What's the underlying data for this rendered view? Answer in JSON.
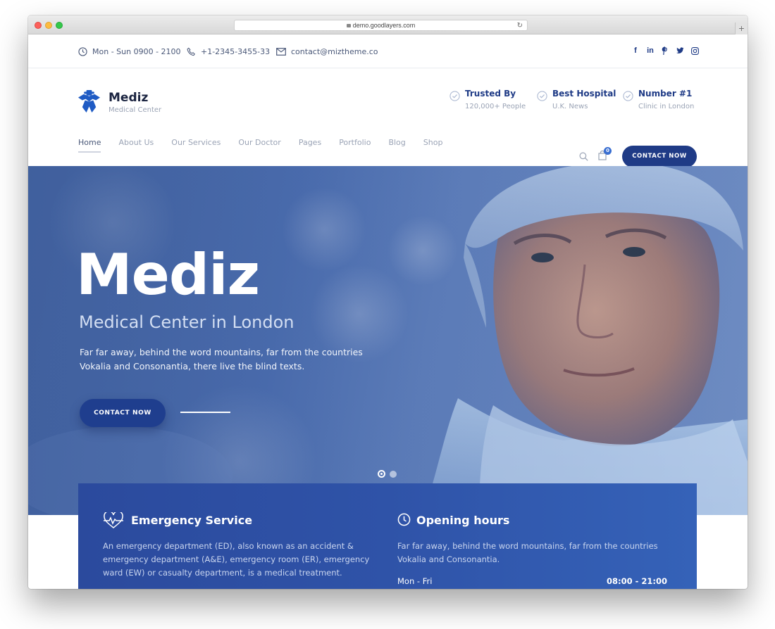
{
  "browser": {
    "url": "demo.goodlayers.com"
  },
  "topbar": {
    "hours": "Mon - Sun 0900 - 2100",
    "phone": "+1-2345-3455-33",
    "email": "contact@miztheme.co",
    "socials": [
      "facebook-icon",
      "linkedin-icon",
      "pinterest-icon",
      "twitter-icon",
      "instagram-icon"
    ]
  },
  "header": {
    "logo": {
      "name": "Mediz",
      "tagline": "Medical Center"
    },
    "badges": [
      {
        "title": "Trusted By",
        "subtitle": "120,000+ People"
      },
      {
        "title": "Best Hospital",
        "subtitle": "U.K. News"
      },
      {
        "title": "Number #1",
        "subtitle": "Clinic in London"
      }
    ],
    "nav": [
      "Home",
      "About Us",
      "Our Services",
      "Our Doctor",
      "Pages",
      "Portfolio",
      "Blog",
      "Shop"
    ],
    "active_nav": "Home",
    "cart_count": "0",
    "cta": "CONTACT NOW"
  },
  "hero": {
    "title": "Mediz",
    "subtitle": "Medical Center in London",
    "description": "Far far away, behind the word mountains, far from the countries Vokalia and Consonantia, there live the blind texts.",
    "cta": "CONTACT NOW",
    "slides": 2,
    "active_slide": 1
  },
  "info": {
    "emergency": {
      "title": "Emergency Service",
      "text": "An emergency department (ED), also known as an accident & emergency department (A&E), emergency room (ER), emergency ward (EW) or casualty department, is a medical treatment."
    },
    "hours": {
      "title": "Opening hours",
      "text": "Far far away, behind the word mountains, far from the countries Vokalia and Consonantia.",
      "row_day": "Mon - Fri",
      "row_time": "08:00 - 21:00"
    }
  },
  "colors": {
    "brand_navy": "#1f3b86",
    "hero_blue": "#4c6eb0",
    "panel_blue": "#2f53a8",
    "muted_text": "#9aa3b5"
  }
}
